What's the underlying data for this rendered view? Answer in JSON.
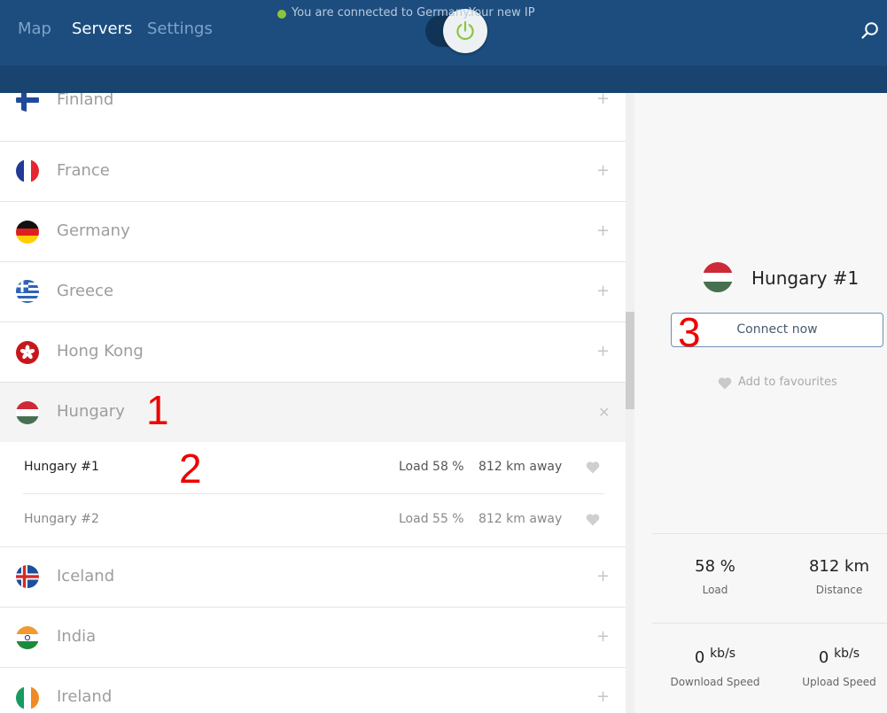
{
  "nav": {
    "tabs": [
      {
        "label": "Map",
        "active": false
      },
      {
        "label": "Servers",
        "active": true
      },
      {
        "label": "Settings",
        "active": false
      }
    ],
    "power_state": "connected",
    "search_icon": "search-icon"
  },
  "status": {
    "text": "You are connected to Germany.",
    "ip_link": "Your new IP",
    "dot_color": "#8bc53f"
  },
  "countries": [
    {
      "name": "Finland",
      "flag": "finland-flag"
    },
    {
      "name": "France",
      "flag": "france-flag"
    },
    {
      "name": "Germany",
      "flag": "germany-flag"
    },
    {
      "name": "Greece",
      "flag": "greece-flag"
    },
    {
      "name": "Hong Kong",
      "flag": "hong-kong-flag"
    },
    {
      "name": "Hungary",
      "flag": "hungary-flag",
      "expanded": true
    },
    {
      "name": "Iceland",
      "flag": "iceland-flag"
    },
    {
      "name": "India",
      "flag": "india-flag"
    },
    {
      "name": "Ireland",
      "flag": "ireland-flag"
    }
  ],
  "servers": [
    {
      "name": "Hungary #1",
      "load": "Load 58 %",
      "distance": "812 km away",
      "selected": true
    },
    {
      "name": "Hungary #2",
      "load": "Load 55 %",
      "distance": "812 km away",
      "selected": false
    }
  ],
  "panel": {
    "title": "Hungary #1",
    "connect_label": "Connect now",
    "favourite_label": "Add to favourites",
    "stats": [
      {
        "value": "58 %",
        "label": "Load"
      },
      {
        "value": "812 km",
        "label": "Distance"
      },
      {
        "value": "0",
        "unit": "kb/s",
        "label": "Download Speed"
      },
      {
        "value": "0",
        "unit": "kb/s",
        "label": "Upload Speed"
      }
    ]
  },
  "annotations": [
    "1",
    "2",
    "3"
  ],
  "colors": {
    "topbar": "#1c4d7e",
    "statusbar": "#1a4470",
    "power_icon": "#8bc53f",
    "annotation": "#ee0000"
  }
}
